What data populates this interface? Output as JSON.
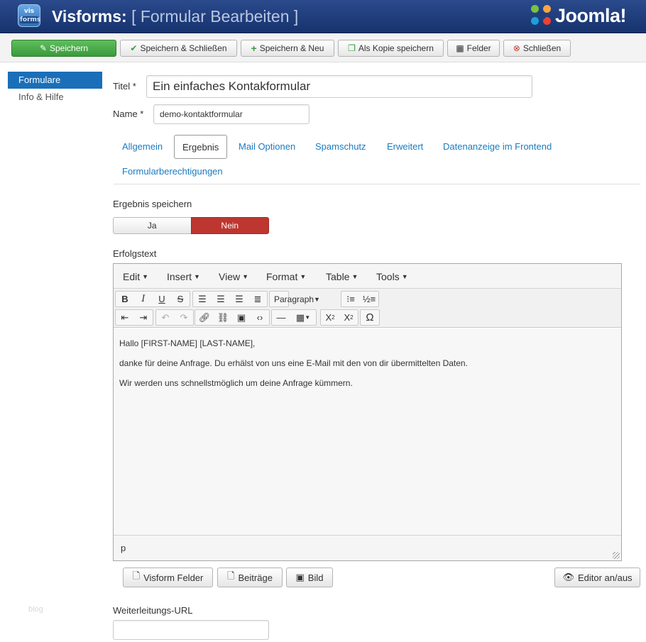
{
  "header": {
    "logo_top": "vis",
    "logo_bottom": "forms",
    "app_name": "Visforms:",
    "page_title": "[ Formular Bearbeiten ]",
    "brand": "Joomla!"
  },
  "toolbar": {
    "save": "Speichern",
    "save_close": "Speichern & Schließen",
    "save_new": "Speichern & Neu",
    "save_copy": "Als Kopie speichern",
    "fields": "Felder",
    "close": "Schließen"
  },
  "sidebar": {
    "items": [
      {
        "label": "Formulare",
        "active": true
      },
      {
        "label": "Info & Hilfe",
        "active": false
      }
    ],
    "watermark": "blog"
  },
  "form": {
    "title_label": "Titel *",
    "title_value": "Ein einfaches Kontakformular",
    "name_label": "Name *",
    "name_value": "demo-kontaktformular"
  },
  "tabs": [
    {
      "label": "Allgemein",
      "active": false
    },
    {
      "label": "Ergebnis",
      "active": true
    },
    {
      "label": "Mail Optionen",
      "active": false
    },
    {
      "label": "Spamschutz",
      "active": false
    },
    {
      "label": "Erweitert",
      "active": false
    },
    {
      "label": "Datenanzeige im Frontend",
      "active": false
    },
    {
      "label": "Formularberechtigungen",
      "active": false
    }
  ],
  "result": {
    "save_label": "Ergebnis speichern",
    "yes": "Ja",
    "no": "Nein",
    "selected": "Nein",
    "success_label": "Erfolgstext"
  },
  "editor": {
    "menus": [
      "Edit",
      "Insert",
      "View",
      "Format",
      "Table",
      "Tools"
    ],
    "format_select": "Paragraph",
    "content": [
      "Hallo [FIRST-NAME] [LAST-NAME],",
      "danke für deine Anfrage. Du erhälst von uns eine E-Mail mit den von dir übermittelten Daten.",
      "Wir werden uns schnellstmöglich um deine Anfrage kümmern."
    ],
    "path": "p"
  },
  "editor_buttons": {
    "visform_fields": "Visform Felder",
    "articles": "Beiträge",
    "image": "Bild",
    "toggle": "Editor an/aus"
  },
  "redirect": {
    "label": "Weiterleitungs-URL",
    "value": ""
  },
  "colors": {
    "header": "#1f3e7e",
    "save_green": "#4cae4c",
    "accent_blue": "#1a6fb8",
    "no_red": "#bd362f",
    "link": "#1a7bbf"
  }
}
